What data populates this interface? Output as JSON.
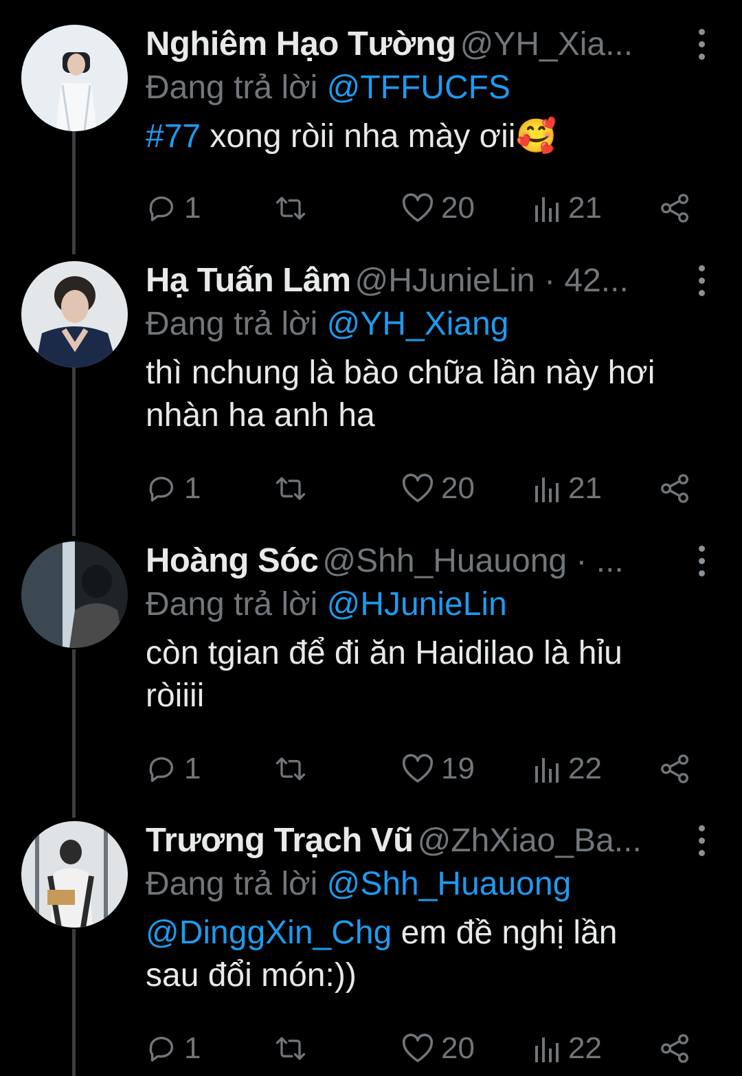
{
  "thread": {
    "tweets": [
      {
        "name": "Nghiêm Hạo Tường",
        "handle": "@YH_Xia...",
        "reply_prefix": "Đang trả lời",
        "reply_to": "@TFFUCFS",
        "text_mention": "#77",
        "text_line1": " xong ròii nha mày ơii🥰",
        "text_line2": "",
        "counts": {
          "replies": "1",
          "likes": "20",
          "views": "21"
        }
      },
      {
        "name": "Hạ Tuấn Lâm",
        "handle": "@HJunieLin · 42...",
        "reply_prefix": "Đang trả lời",
        "reply_to": "@YH_Xiang",
        "text_mention": "",
        "text_line1": "thì nchung là bào chữa lần này hơi",
        "text_line2": "nhàn ha anh ha",
        "counts": {
          "replies": "1",
          "likes": "20",
          "views": "21"
        }
      },
      {
        "name": "Hoàng Sóc",
        "handle": "@Shh_Huauong · ...",
        "reply_prefix": "Đang trả lời",
        "reply_to": "@HJunieLin",
        "text_mention": "",
        "text_line1": "còn tgian để đi ăn Haidilao là hỉu",
        "text_line2": "ròiiii",
        "counts": {
          "replies": "1",
          "likes": "19",
          "views": "22"
        }
      },
      {
        "name": "Trương Trạch Vũ",
        "handle": "@ZhXiao_Ba...",
        "reply_prefix": "Đang trả lời",
        "reply_to": "@Shh_Huauong",
        "text_mention": "@DinggXin_Chg",
        "text_line1": " em đề nghị lần",
        "text_line2": "sau đổi món:))",
        "counts": {
          "replies": "1",
          "likes": "20",
          "views": "22"
        }
      }
    ]
  },
  "icons": {
    "reply": "reply-icon",
    "retweet": "retweet-icon",
    "like": "heart-icon",
    "views": "views-icon",
    "share": "share-icon",
    "more": "more-vertical-icon"
  },
  "colors": {
    "background": "#000000",
    "text": "#e7e9ea",
    "muted": "#71767b",
    "accent": "#1d9bf0"
  }
}
